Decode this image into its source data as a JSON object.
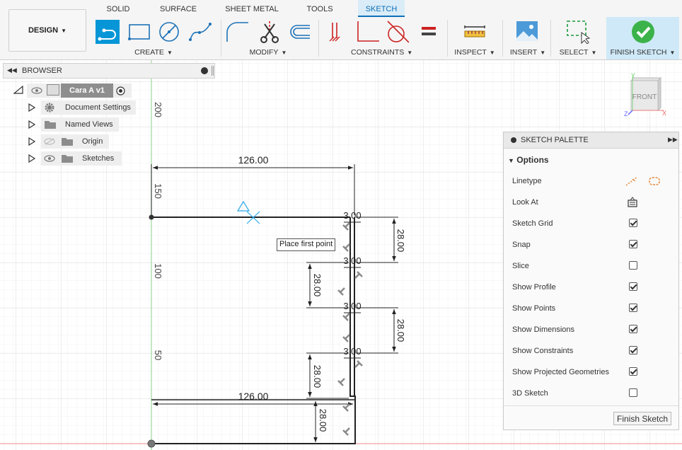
{
  "toolbar": {
    "tabs": [
      {
        "label": "SOLID"
      },
      {
        "label": "SURFACE"
      },
      {
        "label": "SHEET METAL"
      },
      {
        "label": "TOOLS"
      },
      {
        "label": "SKETCH",
        "active": true
      }
    ],
    "workspace": {
      "label": "DESIGN"
    },
    "groups": {
      "create": "CREATE",
      "modify": "MODIFY",
      "constraints": "CONSTRAINTS",
      "inspect": "INSPECT",
      "insert": "INSERT",
      "select": "SELECT",
      "finish": "FINISH SKETCH"
    },
    "icons": [
      "line-icon",
      "rectangle-icon",
      "circle-icon",
      "spline-icon",
      "fillet-icon",
      "trim-icon",
      "offset-icon",
      "coincident-icon",
      "perpendicular-icon",
      "tangent-icon",
      "equal-icon",
      "measure-icon",
      "insert-image-icon",
      "select-window-icon",
      "finish-check-icon"
    ],
    "accent": "#0696d7"
  },
  "browser": {
    "title": "BROWSER",
    "root": {
      "label": "Cara A v1"
    },
    "items": [
      {
        "label": "Document Settings",
        "icon": "gear-icon"
      },
      {
        "label": "Named Views",
        "icon": "folder-icon"
      },
      {
        "label": "Origin",
        "icon": "folder-icon"
      },
      {
        "label": "Sketches",
        "icon": "folder-icon"
      }
    ]
  },
  "viewcube": {
    "face": "FRONT",
    "axis_y": "Y",
    "axis_x": "X",
    "axis_z": "Z"
  },
  "sketch": {
    "ruler": [
      "200",
      "150",
      "100",
      "50"
    ],
    "dimensions": {
      "top_width": "126.00",
      "bottom_width": "126.00",
      "thickness": [
        "3.00",
        "3.00",
        "3.00",
        "3.00"
      ],
      "right_heights": [
        "28.00",
        "28.00"
      ],
      "left_heights": [
        "28.00",
        "28.00"
      ],
      "bottom_height": "28.00"
    },
    "tooltip": "Place first point"
  },
  "palette": {
    "title": "SKETCH PALETTE",
    "section": "Options",
    "options": [
      {
        "label": "Linetype",
        "type": "icons"
      },
      {
        "label": "Look At",
        "type": "icon"
      },
      {
        "label": "Sketch Grid",
        "checked": true
      },
      {
        "label": "Snap",
        "checked": true
      },
      {
        "label": "Slice",
        "checked": false
      },
      {
        "label": "Show Profile",
        "checked": true
      },
      {
        "label": "Show Points",
        "checked": true
      },
      {
        "label": "Show Dimensions",
        "checked": true
      },
      {
        "label": "Show Constraints",
        "checked": true
      },
      {
        "label": "Show Projected Geometries",
        "checked": true
      },
      {
        "label": "3D Sketch",
        "checked": false
      }
    ],
    "finish_button": "Finish Sketch"
  }
}
